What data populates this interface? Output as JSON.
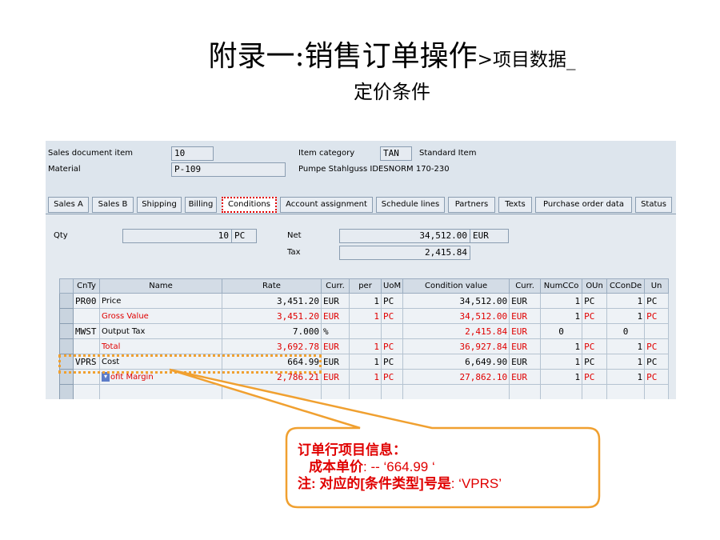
{
  "slide": {
    "title_main": "附录一:销售订单操作",
    "title_tail": ">项目数据_",
    "title_line2": "定价条件"
  },
  "header": {
    "item_label": "Sales document item",
    "item_value": "10",
    "material_label": "Material",
    "material_value": "P-109",
    "category_label": "Item category",
    "category_value": "TAN",
    "category_desc": "Standard Item",
    "material_desc": "Pumpe Stahlguss IDESNORM 170-230"
  },
  "tabs": [
    {
      "label": "Sales A"
    },
    {
      "label": "Sales B"
    },
    {
      "label": "Shipping"
    },
    {
      "label": "Billing"
    },
    {
      "label": "Conditions"
    },
    {
      "label": "Account assignment"
    },
    {
      "label": "Schedule lines"
    },
    {
      "label": "Partners"
    },
    {
      "label": "Texts"
    },
    {
      "label": "Purchase order data"
    },
    {
      "label": "Status"
    }
  ],
  "conditions": {
    "qty_label": "Qty",
    "qty_value": "10",
    "qty_unit": "PC",
    "net_label": "Net",
    "net_value": "34,512.00",
    "net_curr": "EUR",
    "tax_label": "Tax",
    "tax_value": "2,415.84"
  },
  "grid": {
    "columns": [
      "CnTy",
      "Name",
      "Rate",
      "Curr.",
      "per",
      "UoM",
      "Condition value",
      "Curr.",
      "NumCCo",
      "OUn",
      "CConDe",
      "Un"
    ],
    "rows": [
      {
        "cnty": "PR00",
        "name": "Price",
        "rate": "3,451.20",
        "curr": "EUR",
        "per": "1",
        "uom": "PC",
        "value": "34,512.00",
        "curr2": "EUR",
        "num": "1",
        "oun": "PC",
        "ccon": "1",
        "un": "PC"
      },
      {
        "cnty": "",
        "name": "Gross Value",
        "rate": "3,451.20",
        "curr": "EUR",
        "per": "1",
        "uom": "PC",
        "value": "34,512.00",
        "curr2": "EUR",
        "num": "1",
        "oun": "PC",
        "ccon": "1",
        "un": "PC"
      },
      {
        "cnty": "MWST",
        "name": "Output Tax",
        "rate": "7.000",
        "curr": "%",
        "per": "",
        "uom": "",
        "value": "2,415.84",
        "curr2": "EUR",
        "num": "0",
        "oun": "",
        "ccon": "0",
        "un": ""
      },
      {
        "cnty": "",
        "name": "Total",
        "rate": "3,692.78",
        "curr": "EUR",
        "per": "1",
        "uom": "PC",
        "value": "36,927.84",
        "curr2": "EUR",
        "num": "1",
        "oun": "PC",
        "ccon": "1",
        "un": "PC"
      },
      {
        "cnty": "VPRS",
        "name": "Cost",
        "rate": "664.99",
        "curr": "EUR",
        "per": "1",
        "uom": "PC",
        "value": "6,649.90",
        "curr2": "EUR",
        "num": "1",
        "oun": "PC",
        "ccon": "1",
        "un": "PC"
      },
      {
        "cnty": "",
        "name": "ofit Margin",
        "rate": "2,786.21",
        "curr": "EUR",
        "per": "1",
        "uom": "PC",
        "value": "27,862.10",
        "curr2": "EUR",
        "num": "1",
        "oun": "PC",
        "ccon": "1",
        "un": "PC"
      }
    ]
  },
  "callout": {
    "line1": "订单行项目信息：",
    "line2_label": "成本单价",
    "line2_value": ":  -- ‘664.99 ‘",
    "line3_label": "注",
    "line3_mid": ": 对应的[条件类型]号是",
    "line3_value": ": ‘VPRS’"
  },
  "colors": {
    "accent_red": "#e00000",
    "highlight_orange": "#f0a030",
    "sap_background": "#dde5ed"
  }
}
